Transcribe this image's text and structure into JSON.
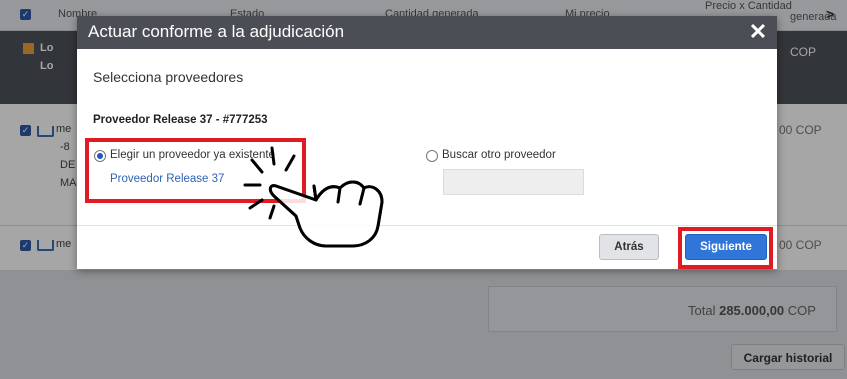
{
  "header": {
    "col_name": "Nombre",
    "col_state": "Estado",
    "col_qty": "Cantidad generada",
    "col_price": "Mi precio",
    "col_total": "Precio x Cantidad",
    "col_total2": "generada"
  },
  "lot": {
    "line1": "Lo",
    "line2": "Lo",
    "currency": "COP"
  },
  "rows": [
    {
      "name": "me",
      "line2": "-8",
      "line3": "DE",
      "line4": "MA",
      "price": "00 COP"
    },
    {
      "name": "me",
      "price": "00 COP"
    }
  ],
  "total": {
    "label": "Total",
    "amount": "285.000,00",
    "currency": "COP"
  },
  "load_history_label": "Cargar historial",
  "modal": {
    "title": "Actuar conforme a la adjudicación",
    "close_glyph": "✕",
    "subtitle": "Selecciona proveedores",
    "supplier_heading": "Proveedor Release 37 - #777253",
    "option_existing": "Elegir un proveedor ya existente",
    "existing_supplier_link": "Proveedor Release 37",
    "option_other": "Buscar otro proveedor",
    "back_label": "Atrás",
    "next_label": "Siguiente"
  },
  "colors": {
    "accent": "#2f76d8",
    "highlight": "#e01b24",
    "modal_header": "#4b4f55"
  },
  "icons": [
    "checkbox-icon",
    "lot-icon",
    "cart-icon",
    "close-icon",
    "chevron-right-icon",
    "pointing-hand-icon"
  ]
}
